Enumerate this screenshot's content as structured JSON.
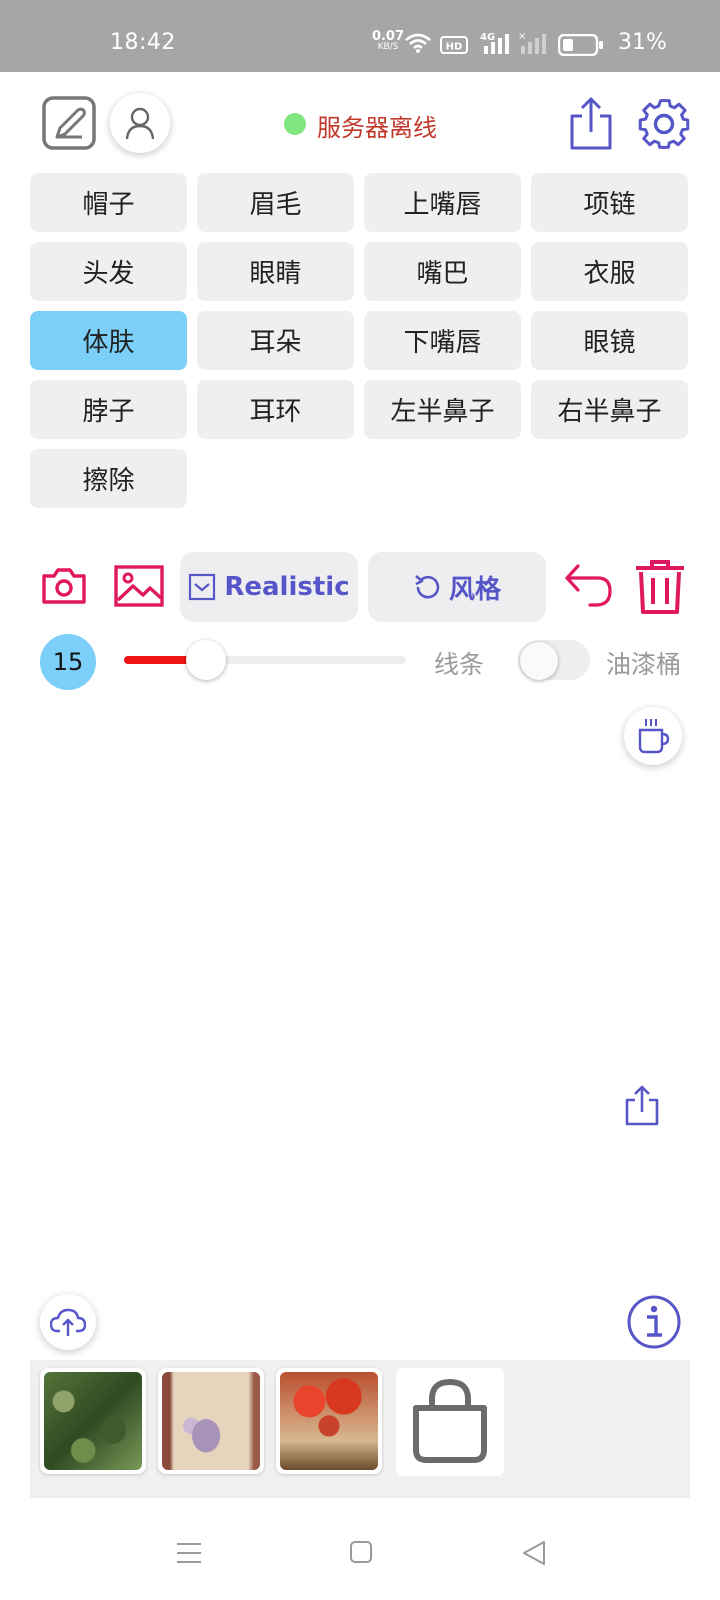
{
  "status_bar": {
    "time": "18:42",
    "net_speed_value": "0.07",
    "net_speed_unit": "KB/S",
    "battery_percent": "31%",
    "icons": [
      "wifi-icon",
      "hd-icon",
      "4g-signal-icon",
      "signal-off-icon",
      "battery-icon"
    ]
  },
  "header": {
    "server_status": "服务器离线",
    "server_status_color": "#7fe57d",
    "icons": [
      "draw-edit-icon",
      "user-icon",
      "export-icon",
      "settings-icon"
    ]
  },
  "part_buttons": [
    {
      "label": "帽子",
      "selected": false
    },
    {
      "label": "眉毛",
      "selected": false
    },
    {
      "label": "上嘴唇",
      "selected": false
    },
    {
      "label": "项链",
      "selected": false
    },
    {
      "label": "头发",
      "selected": false
    },
    {
      "label": "眼睛",
      "selected": false
    },
    {
      "label": "嘴巴",
      "selected": false
    },
    {
      "label": "衣服",
      "selected": false
    },
    {
      "label": "体肤",
      "selected": true
    },
    {
      "label": "耳朵",
      "selected": false
    },
    {
      "label": "下嘴唇",
      "selected": false
    },
    {
      "label": "眼镜",
      "selected": false
    },
    {
      "label": "脖子",
      "selected": false
    },
    {
      "label": "耳环",
      "selected": false
    },
    {
      "label": "左半鼻子",
      "selected": false
    },
    {
      "label": "右半鼻子",
      "selected": false
    },
    {
      "label": "擦除",
      "selected": false
    }
  ],
  "tools": {
    "style_mode_label": "Realistic",
    "style_button_label": "风格",
    "icons": [
      "camera-icon",
      "gallery-icon",
      "undo-icon",
      "trash-icon"
    ]
  },
  "brush": {
    "size": "15",
    "slider_value": 15,
    "line_label": "线条",
    "bucket_label": "油漆桶",
    "bucket_enabled": false
  },
  "colors": {
    "accent_pink": "#e0185f",
    "accent_purple": "#5656c8",
    "selected_blue": "#7bcff8",
    "slider_red": "#ee1414"
  },
  "floating": {
    "icons": [
      "coffee-icon",
      "share-icon",
      "cloud-upload-icon",
      "info-icon"
    ]
  },
  "gallery": {
    "thumbnails": [
      "thumbnail-1",
      "thumbnail-2",
      "thumbnail-3"
    ],
    "store_icon": "shopping-bag-icon"
  },
  "nav": {
    "icons": [
      "menu-icon",
      "home-icon",
      "back-icon"
    ]
  }
}
